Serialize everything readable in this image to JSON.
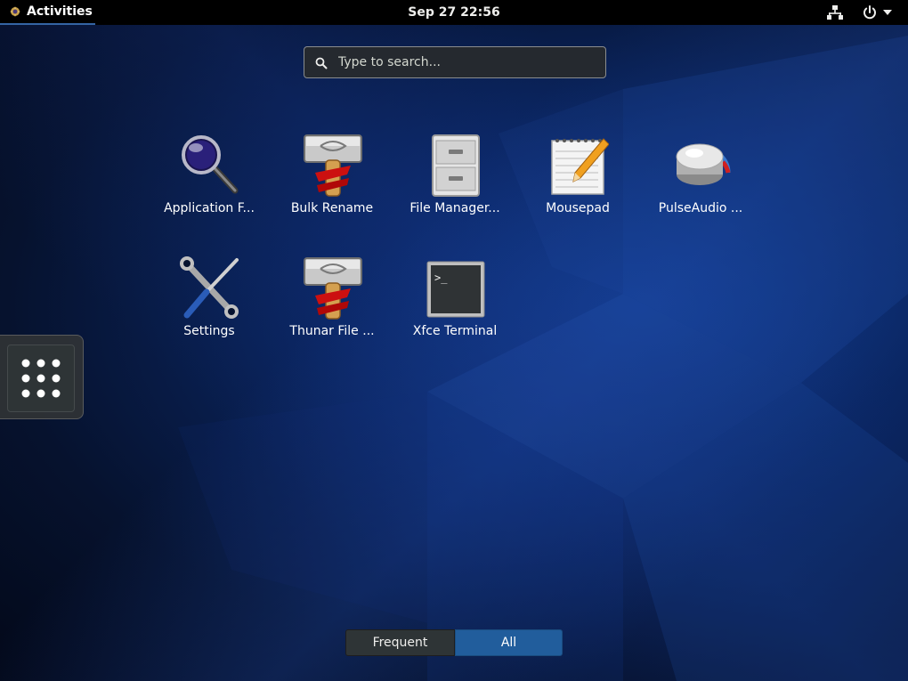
{
  "topbar": {
    "activities_label": "Activities",
    "clock": "Sep 27  22:56",
    "icons": [
      "activities-logo-icon",
      "network-icon",
      "power-icon",
      "chevron-down-icon"
    ]
  },
  "search": {
    "placeholder": "Type to search..."
  },
  "apps": [
    {
      "label": "Application F...",
      "icon": "magnifier-icon"
    },
    {
      "label": "Bulk Rename",
      "icon": "hammer-icon"
    },
    {
      "label": "File Manager...",
      "icon": "file-cabinet-icon"
    },
    {
      "label": "Mousepad",
      "icon": "notepad-icon"
    },
    {
      "label": "PulseAudio ...",
      "icon": "volume-knob-icon"
    },
    {
      "label": "Settings",
      "icon": "tools-icon"
    },
    {
      "label": "Thunar File ...",
      "icon": "hammer-icon"
    },
    {
      "label": "Xfce Terminal",
      "icon": "terminal-icon"
    }
  ],
  "switcher": {
    "frequent_label": "Frequent",
    "all_label": "All",
    "selected": "All"
  },
  "colors": {
    "accent": "#215d9c",
    "topbar": "#000000",
    "background": "#0a2560"
  }
}
